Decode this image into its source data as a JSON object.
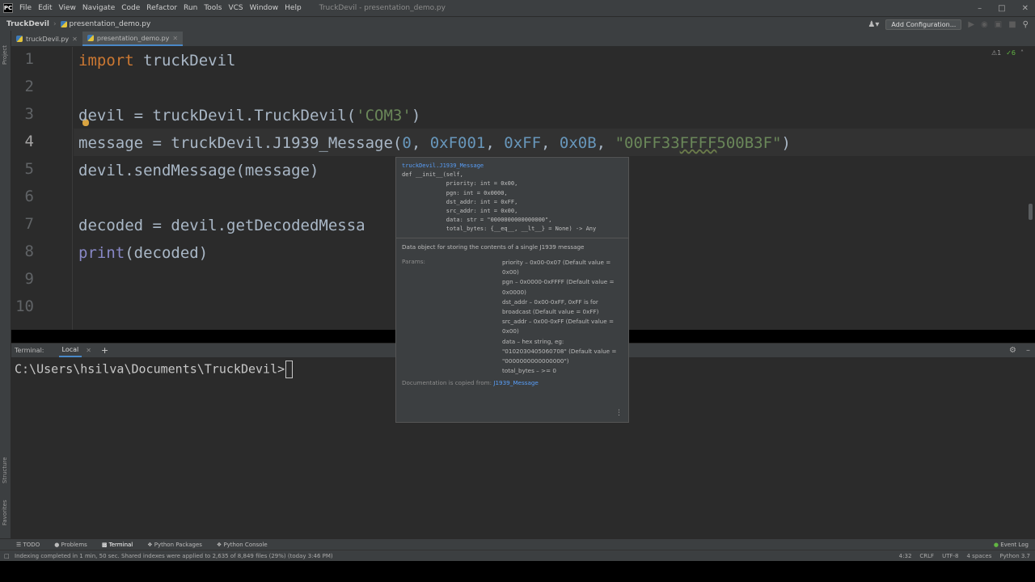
{
  "menubar": {
    "items": [
      "File",
      "Edit",
      "View",
      "Navigate",
      "Code",
      "Refactor",
      "Run",
      "Tools",
      "VCS",
      "Window",
      "Help"
    ],
    "window_title": "TruckDevil - presentation_demo.py"
  },
  "navbar": {
    "project": "TruckDevil",
    "file": "presentation_demo.py",
    "add_config": "Add Configuration..."
  },
  "left_strip": {
    "project_label": "Project",
    "structure_label": "Structure",
    "favorites_label": "Favorites"
  },
  "tabs": [
    {
      "label": "truckDevil.py"
    },
    {
      "label": "presentation_demo.py"
    }
  ],
  "editor": {
    "line_numbers": [
      "1",
      "2",
      "3",
      "4",
      "5",
      "6",
      "7",
      "8",
      "9",
      "10"
    ],
    "inspection": {
      "warnings": "1",
      "ok": "6"
    },
    "lines": {
      "l1_kw": "import",
      "l1_rest": " truckDevil",
      "l3_a": "devil = truckDevil.TruckDevil(",
      "l3_str": "'COM3'",
      "l3_b": ")",
      "l4_a": "message = truckDevil.J1939_Message(",
      "l4_n1": "0",
      "l4_c1": ", ",
      "l4_n2": "0xF001",
      "l4_c2": ", ",
      "l4_n3": "0xFF",
      "l4_c3": ", ",
      "l4_n4": "0x0B",
      "l4_c4": ", ",
      "l4_s1": "\"00FF33",
      "l4_s2": "FFFF",
      "l4_s3": "500B3F\"",
      "l4_b": ")",
      "l5": "devil.sendMessage(message)",
      "l7": "decoded = devil.getDecodedMessa",
      "l8_bi": "print",
      "l8_rest": "(decoded)"
    }
  },
  "popup": {
    "link": "truckDevil.J1939_Message",
    "sig": [
      "def __init__(self,",
      "             priority: int = 0x00,",
      "             pgn: int = 0x0000,",
      "             dst_addr: int = 0xFF,",
      "             src_addr: int = 0x00,",
      "             data: str = \"0000000000000000\",",
      "             total_bytes: {__eq__, __lt__} = None) -> Any"
    ],
    "description": "Data object for storing the contents of a single J1939 message",
    "params_label": "Params:",
    "params": [
      "priority – 0x00-0x07 (Default value = 0x00)",
      "pgn – 0x0000-0xFFFF (Default value = 0x0000)",
      "dst_addr – 0x00-0xFF, 0xFF is for broadcast (Default value = 0xFF)",
      "src_addr – 0x00-0xFF (Default value = 0x00)",
      "data – hex string, eg: \"0102030405060708\" (Default value = \"0000000000000000\")",
      "total_bytes – >= 0"
    ],
    "copied_text": "Documentation is copied from: ",
    "copied_link": "J1939_Message"
  },
  "terminal": {
    "title": "Terminal:",
    "tab": "Local",
    "prompt": "C:\\Users\\hsilva\\Documents\\TruckDevil>"
  },
  "bottom_tools": {
    "todo": "TODO",
    "problems": "Problems",
    "terminal": "Terminal",
    "python_packages": "Python Packages",
    "python_console": "Python Console",
    "event_log": "Event Log"
  },
  "status": {
    "message": "Indexing completed in 1 min, 50 sec. Shared indexes were applied to 2,635 of 8,849 files (29%) (today 3:46 PM)",
    "position": "4:32",
    "line_sep": "CRLF",
    "encoding": "UTF-8",
    "indent": "4 spaces",
    "interpreter": "Python 3.7"
  }
}
